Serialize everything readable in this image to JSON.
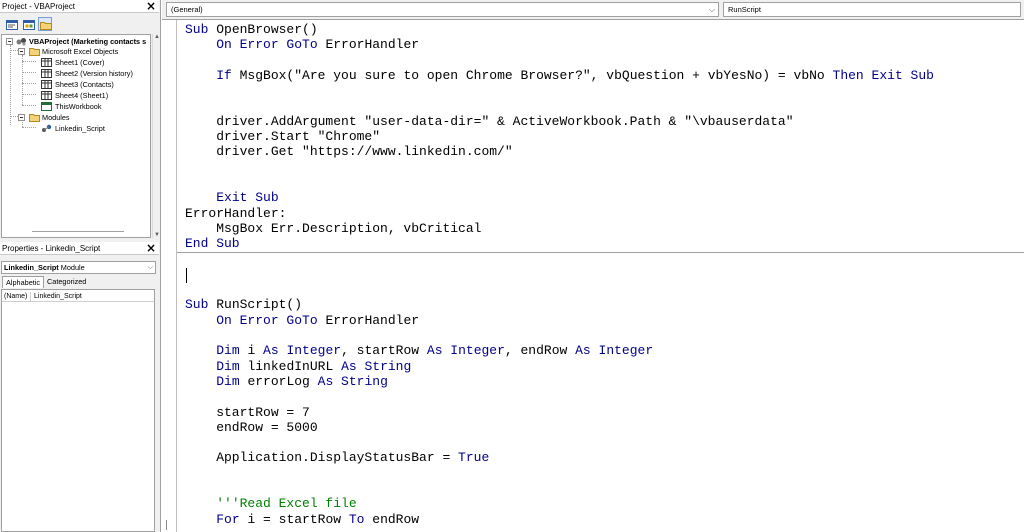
{
  "project_explorer": {
    "title": "Project - VBAProject",
    "toolbar": [
      "view-code-icon",
      "view-object-icon",
      "toggle-folders-icon"
    ],
    "tree": {
      "root": "VBAProject (Marketing contacts s",
      "groups": [
        {
          "label": "Microsoft Excel Objects",
          "items": [
            "Sheet1 (Cover)",
            "Sheet2 (Version history)",
            "Sheet3 (Contacts)",
            "Sheet4 (Sheet1)",
            "ThisWorkbook"
          ]
        },
        {
          "label": "Modules",
          "items": [
            "Linkedin_Script"
          ]
        }
      ]
    }
  },
  "properties": {
    "title": "Properties - Linkedin_Script",
    "object_name": "Linkedin_Script",
    "object_type": "Module",
    "tabs": [
      "Alphabetic",
      "Categorized"
    ],
    "active_tab": "Alphabetic",
    "rows": [
      {
        "name": "(Name)",
        "value": "Linkedin_Script"
      }
    ]
  },
  "editor": {
    "object_combo": "(General)",
    "procedure_combo": "RunScript",
    "lines": [
      [
        {
          "t": "Sub ",
          "c": "kw"
        },
        {
          "t": "OpenBrowser()"
        }
      ],
      [
        {
          "t": "    "
        },
        {
          "t": "On Error GoTo ",
          "c": "kw"
        },
        {
          "t": "ErrorHandler"
        }
      ],
      [],
      [
        {
          "t": "    "
        },
        {
          "t": "If ",
          "c": "kw"
        },
        {
          "t": "MsgBox(\"Are you sure to open Chrome Browser?\", vbQuestion + vbYesNo) = vbNo "
        },
        {
          "t": "Then Exit Sub",
          "c": "kw"
        }
      ],
      [],
      [],
      [
        {
          "t": "    driver.AddArgument \"user-data-dir=\" & ActiveWorkbook.Path & \"\\vbauserdata\""
        }
      ],
      [
        {
          "t": "    driver.Start \"Chrome\""
        }
      ],
      [
        {
          "t": "    driver.Get \"https://www.linkedin.com/\""
        }
      ],
      [],
      [],
      [
        {
          "t": "    "
        },
        {
          "t": "Exit Sub",
          "c": "kw"
        }
      ],
      [
        {
          "t": "ErrorHandler:"
        }
      ],
      [
        {
          "t": "    MsgBox Err.Description, vbCritical"
        }
      ],
      [
        {
          "t": "End Sub",
          "c": "kw"
        }
      ],
      [],
      [],
      [],
      [
        {
          "t": "Sub ",
          "c": "kw"
        },
        {
          "t": "RunScript()"
        }
      ],
      [
        {
          "t": "    "
        },
        {
          "t": "On Error GoTo ",
          "c": "kw"
        },
        {
          "t": "ErrorHandler"
        }
      ],
      [],
      [
        {
          "t": "    "
        },
        {
          "t": "Dim ",
          "c": "kw"
        },
        {
          "t": "i "
        },
        {
          "t": "As Integer",
          "c": "kw"
        },
        {
          "t": ", startRow "
        },
        {
          "t": "As Integer",
          "c": "kw"
        },
        {
          "t": ", endRow "
        },
        {
          "t": "As Integer",
          "c": "kw"
        }
      ],
      [
        {
          "t": "    "
        },
        {
          "t": "Dim ",
          "c": "kw"
        },
        {
          "t": "linkedInURL "
        },
        {
          "t": "As String",
          "c": "kw"
        }
      ],
      [
        {
          "t": "    "
        },
        {
          "t": "Dim ",
          "c": "kw"
        },
        {
          "t": "errorLog "
        },
        {
          "t": "As String",
          "c": "kw"
        }
      ],
      [],
      [
        {
          "t": "    startRow = 7"
        }
      ],
      [
        {
          "t": "    endRow = 5000"
        }
      ],
      [],
      [
        {
          "t": "    Application.DisplayStatusBar = "
        },
        {
          "t": "True",
          "c": "kw"
        }
      ],
      [],
      [],
      [
        {
          "t": "    "
        },
        {
          "t": "'''Read Excel file",
          "c": "cm"
        }
      ],
      [
        {
          "t": "    "
        },
        {
          "t": "For ",
          "c": "kw"
        },
        {
          "t": "i = startRow "
        },
        {
          "t": "To ",
          "c": "kw"
        },
        {
          "t": "endRow"
        }
      ]
    ]
  }
}
